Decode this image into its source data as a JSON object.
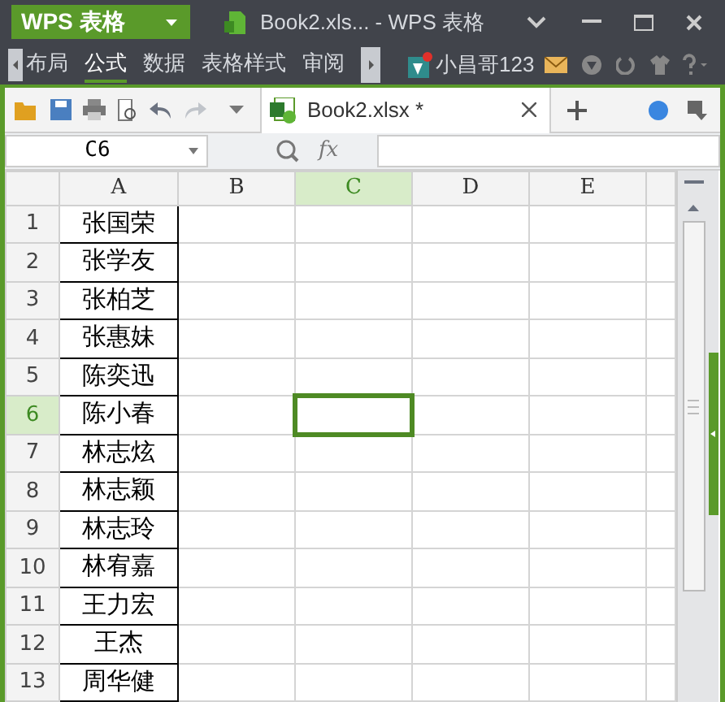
{
  "title_bar": {
    "app_menu": "WPS 表格",
    "title": "Book2.xls... - WPS 表格"
  },
  "ribbon_tabs": [
    {
      "label": "布局",
      "selected": false
    },
    {
      "label": "公式",
      "selected": true
    },
    {
      "label": "数据",
      "selected": false
    },
    {
      "label": "表格样式",
      "selected": false
    },
    {
      "label": "审阅",
      "selected": false
    }
  ],
  "user": {
    "name": "小昌哥123"
  },
  "document_tabs": [
    {
      "label": "Book2.xlsx *",
      "selected": true
    }
  ],
  "name_box": "C6",
  "formula_label": "fx",
  "columns": [
    {
      "label": "A",
      "selected": false
    },
    {
      "label": "B",
      "selected": false
    },
    {
      "label": "C",
      "selected": true
    },
    {
      "label": "D",
      "selected": false
    },
    {
      "label": "E",
      "selected": false
    }
  ],
  "rows": [
    {
      "number": "1",
      "selected": false,
      "cells": [
        "张国荣"
      ]
    },
    {
      "number": "2",
      "selected": false,
      "cells": [
        "张学友"
      ]
    },
    {
      "number": "3",
      "selected": false,
      "cells": [
        "张柏芝"
      ]
    },
    {
      "number": "4",
      "selected": false,
      "cells": [
        "张惠妹"
      ]
    },
    {
      "number": "5",
      "selected": false,
      "cells": [
        "陈奕迅"
      ]
    },
    {
      "number": "6",
      "selected": true,
      "cells": [
        "陈小春"
      ]
    },
    {
      "number": "7",
      "selected": false,
      "cells": [
        "林志炫"
      ]
    },
    {
      "number": "8",
      "selected": false,
      "cells": [
        "林志颖"
      ]
    },
    {
      "number": "9",
      "selected": false,
      "cells": [
        "林志玲"
      ]
    },
    {
      "number": "10",
      "selected": false,
      "cells": [
        "林宥嘉"
      ]
    },
    {
      "number": "11",
      "selected": false,
      "cells": [
        "王力宏"
      ]
    },
    {
      "number": "12",
      "selected": false,
      "cells": [
        "王杰"
      ]
    },
    {
      "number": "13",
      "selected": false,
      "cells": [
        "周华健"
      ]
    }
  ]
}
